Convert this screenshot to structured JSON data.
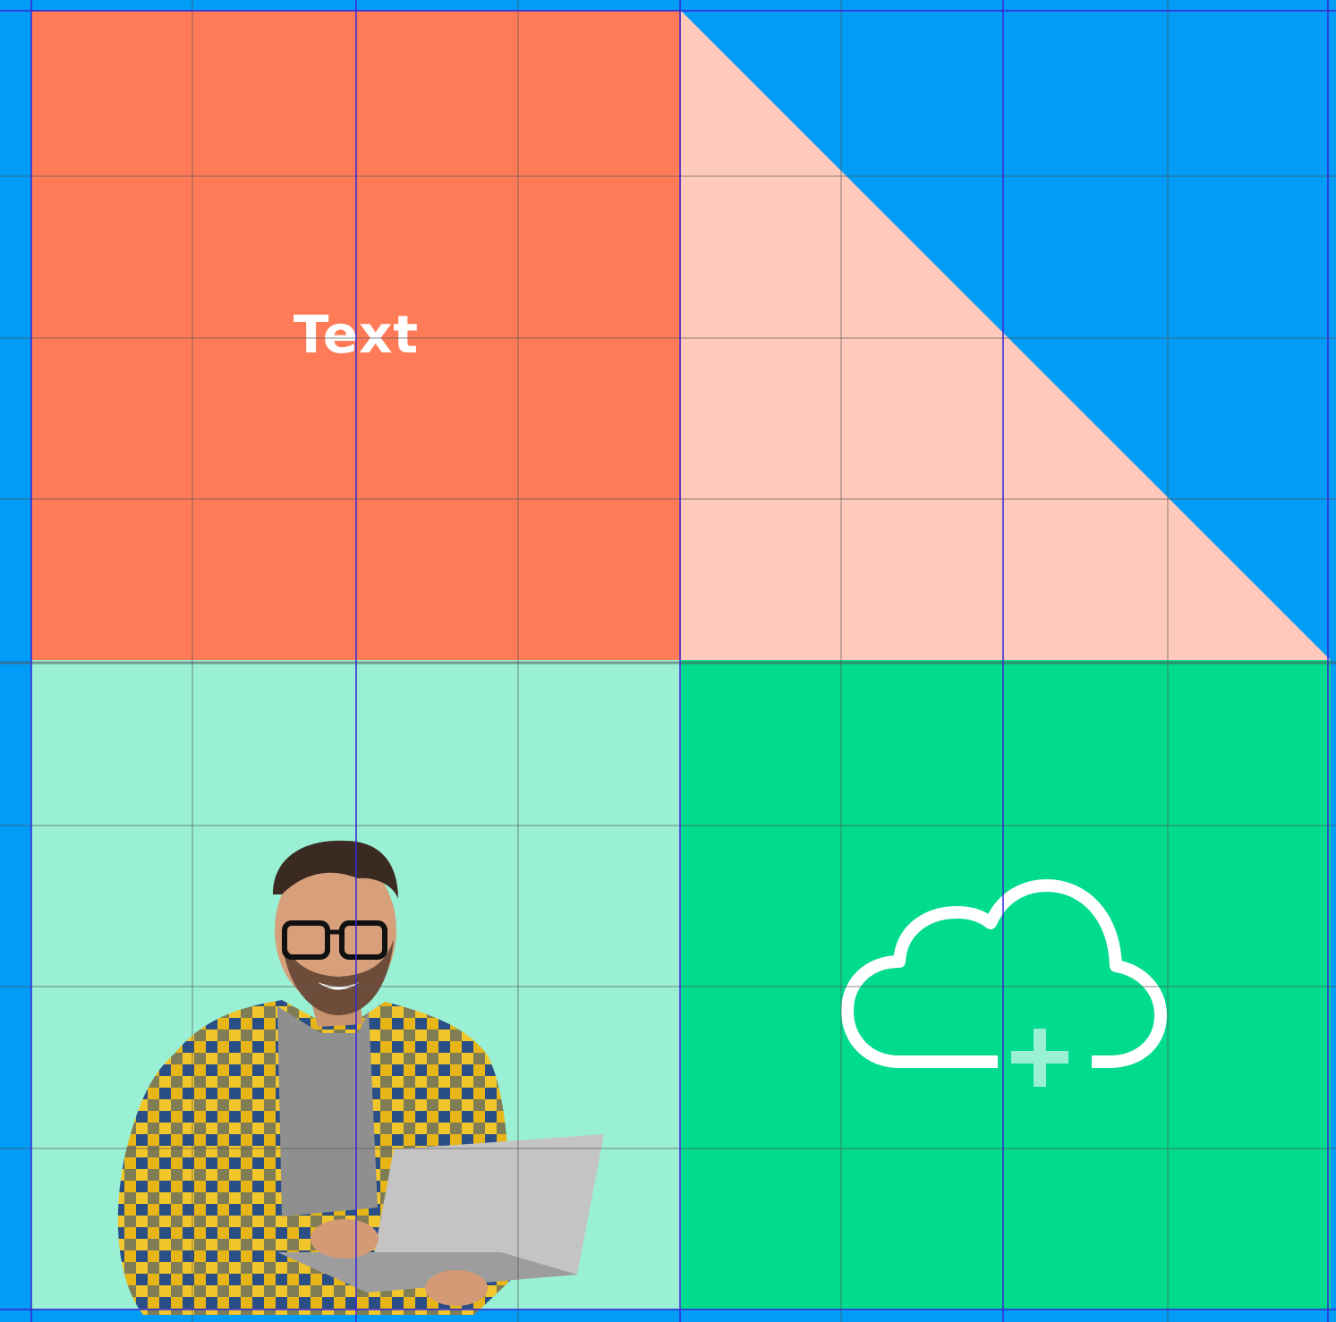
{
  "text_label": "Text",
  "colors": {
    "background": "#009cf5",
    "orange": "#ff7b58",
    "peach": "#ffc9bb",
    "mint": "#9af0d4",
    "green": "#00db8e",
    "grid_line": "#555555",
    "guide_line": "#3a2bd8",
    "white": "#ffffff"
  },
  "icons": {
    "cloud": "cloud-plus-icon",
    "person": "person-with-laptop-photo"
  }
}
